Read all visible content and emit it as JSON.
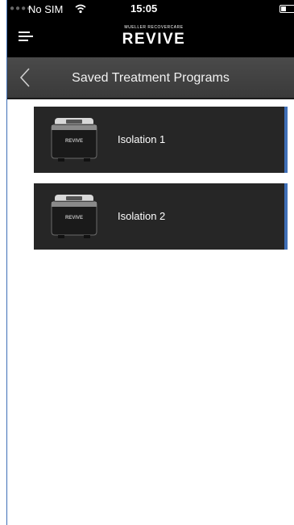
{
  "status_bar": {
    "dots": "●●●●",
    "carrier": "No SIM",
    "time": "15:05"
  },
  "top_bar": {
    "logo_small": "MUELLER RECOVERCARE",
    "logo_text": "REVIVE"
  },
  "title_bar": {
    "title": "Saved Treatment Programs"
  },
  "programs": [
    {
      "name": "Isolation 1",
      "device_label": "REVIVE"
    },
    {
      "name": "Isolation 2",
      "device_label": "REVIVE"
    }
  ],
  "colors": {
    "accent": "#3f6fb7",
    "header_bg": "#000000",
    "titlebar_bg": "#424242",
    "item_bg": "#262626"
  }
}
